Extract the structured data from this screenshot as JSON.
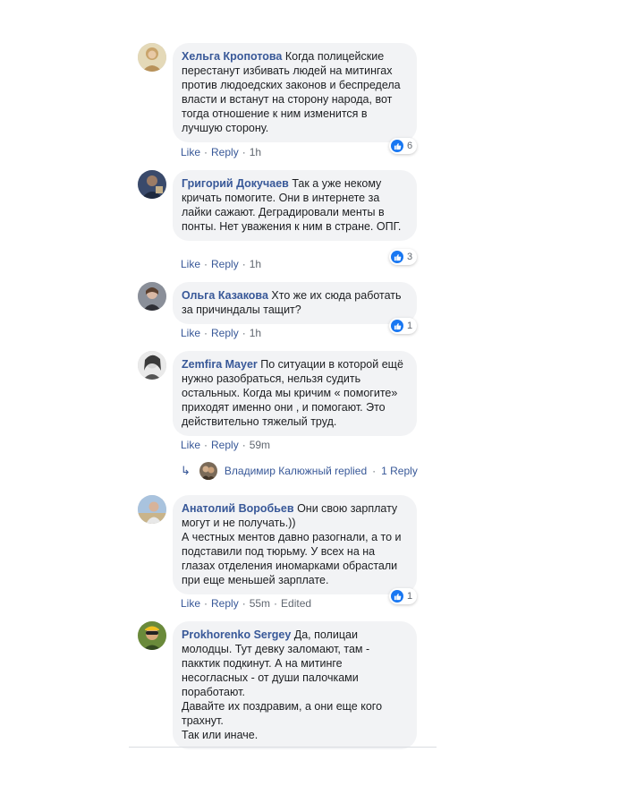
{
  "comments": [
    {
      "author": "Хельга Кропотова",
      "text": "Когда полицейские перестанут избивать людей на митингах против людоедских законов и беспредела власти и встанут на сторону народа, вот тогда отношение к ним изменится в лучшую сторону.",
      "like_label": "Like",
      "reply_label": "Reply",
      "time": "1h",
      "reactions": "6"
    },
    {
      "author": "Григорий Докучаев",
      "text": "Так а уже некому кричать помогите. Они в интернете за лайки сажают. Деградировали менты в понты. Нет уважения к ним в стране. ОПГ.",
      "like_label": "Like",
      "reply_label": "Reply",
      "time": "1h",
      "reactions": "3"
    },
    {
      "author": "Ольга Казакова",
      "text": "Хто же их сюда работать за причиндалы тащит?",
      "like_label": "Like",
      "reply_label": "Reply",
      "time": "1h",
      "reactions": "1"
    },
    {
      "author": "Zemfira Mayer",
      "text": "По ситуации в которой ещё нужно разобраться, нельзя судить остальных. Когда мы кричим « помогите» приходят именно они , и помогают. Это действительно тяжелый труд.",
      "like_label": "Like",
      "reply_label": "Reply",
      "time": "59m",
      "reactions": ""
    },
    {
      "author": "Анатолий Воробьев",
      "text": "Они свою зарплату могут и не получать.))\nА честных ментов давно разогнали, а то и подставили под тюрьму. У всех на на глазах отделения иномарками обрастали при еще меньшей зарплате.",
      "like_label": "Like",
      "reply_label": "Reply",
      "time": "55m",
      "edited": "Edited",
      "reactions": "1"
    },
    {
      "author": "Prokhorenko Sergey",
      "text": "Да, полицаи молодцы. Тут девку заломают, там - пакктик подкинут. А на митинге несогласных - от души палочками поработают.\nДавайте их поздравим, а они еще кого трахнут.\nТак или иначе.",
      "reactions": ""
    }
  ],
  "replies": {
    "name": "Владимир Калюжный replied",
    "separator": "·",
    "count": "1 Reply"
  },
  "icons": {
    "like": "thumbs-up-icon",
    "reply_arrow": "reply-arrow-icon"
  },
  "colors": {
    "link": "#385898",
    "bubble": "#f2f3f5",
    "like_blue": "#1877f2"
  }
}
